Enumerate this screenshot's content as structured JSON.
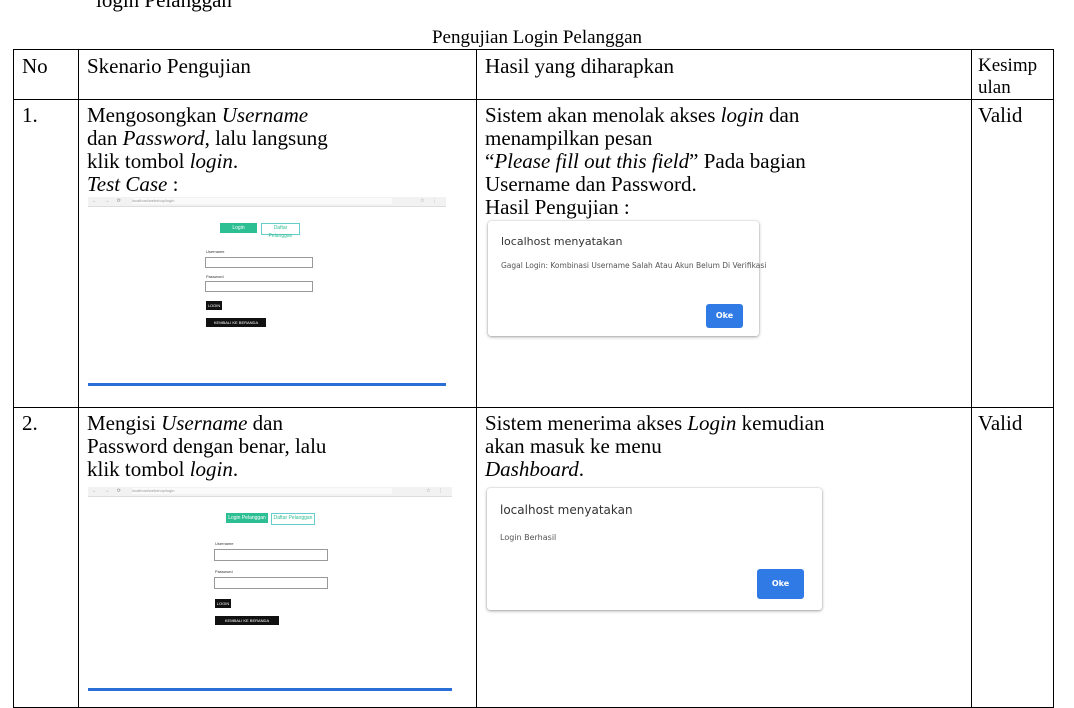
{
  "header_fragment": "login Pelanggan",
  "caption": "Pengujian Login Pelanggan",
  "columns": {
    "no": "No",
    "scenario": "Skenario Pengujian",
    "expected": "Hasil yang diharapkan",
    "conclusion_line1": "Kesimp",
    "conclusion_line2": "ulan"
  },
  "rows": [
    {
      "no": "1.",
      "scenario": {
        "p1": "Mengosongkan ",
        "username": "Username",
        "p2": "dan ",
        "password": "Password",
        "p3": ", lalu langsung",
        "p4": "klik tombol ",
        "login": "login",
        "p5": ".",
        "test_case": "Test Case",
        "test_case_suffix": " :"
      },
      "expected": {
        "p1": "Sistem akan menolak akses ",
        "login": "login",
        "p2": " dan",
        "p3": "menampilkan pesan",
        "q_open": "“",
        "quote": "Please fill out this field",
        "q_close": "”",
        "p4": " Pada bagian",
        "p5": "Username dan Password.",
        "p6": "Hasil Pengujian :"
      },
      "dialog": {
        "title": "localhost menyatakan",
        "message": "Gagal Login: Kombinasi Username Salah Atau Akun Belum Di Verifikasi",
        "button": "Oke"
      },
      "conclusion": "Valid",
      "screenshot": {
        "url_text": "localhost/webshop/login",
        "tab_login": "Login Pelanggan",
        "tab_register": "Daftar Pelanggan",
        "label_username": "Username",
        "label_password": "Password",
        "login_button": "LOGIN",
        "back_button": "KEMBALI KE BERANDA"
      }
    },
    {
      "no": "2.",
      "scenario": {
        "p1": "Mengisi ",
        "username": "Username",
        "p2": " dan",
        "p3": "Password dengan benar, lalu",
        "p4": "klik tombol ",
        "login": "login",
        "p5": "."
      },
      "expected": {
        "p1": "Sistem menerima akses ",
        "login": "Login",
        "p2": " kemudian",
        "p3": "akan masuk ke menu",
        "dashboard": "Dashboard",
        "p4": "."
      },
      "dialog": {
        "title": "localhost menyatakan",
        "message": "Login Berhasil",
        "button": "Oke"
      },
      "conclusion": "Valid",
      "screenshot": {
        "url_text": "localhost/webshop/login",
        "tab_login": "Login Pelanggan",
        "tab_register": "Daftar Pelanggan",
        "label_username": "Username",
        "label_password": "Password",
        "login_button": "LOGIN",
        "back_button": "KEMBALI KE BERANDA"
      }
    }
  ],
  "colors": {
    "accent_green": "#2dbf94",
    "dialog_button": "#2f7ae5",
    "underline_blue": "#2a6fd6"
  }
}
